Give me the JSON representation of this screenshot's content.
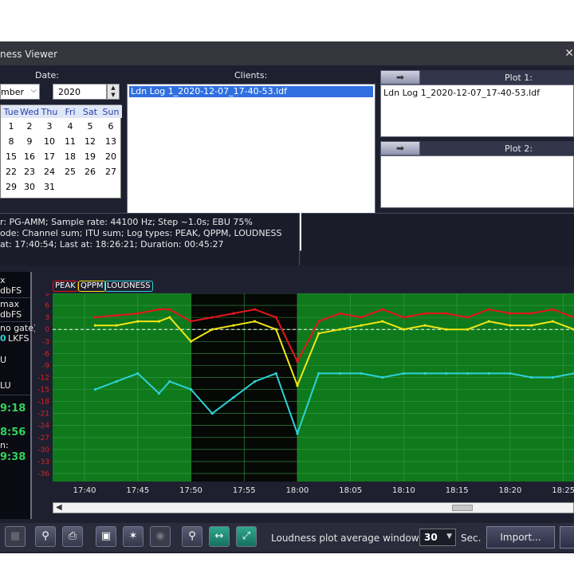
{
  "window": {
    "title": "ness Viewer",
    "close_glyph": "✕"
  },
  "date_pane": {
    "label": "Date:",
    "month_value": "mber",
    "year_value": "2020",
    "calendar": {
      "weekdays": [
        "Tue",
        "Wed",
        "Thu",
        "Fri",
        "Sat",
        "Sun"
      ],
      "weeks": [
        [
          "1",
          "2",
          "3",
          "4",
          "5",
          "6"
        ],
        [
          "8",
          "9",
          "10",
          "11",
          "12",
          "13"
        ],
        [
          "15",
          "16",
          "17",
          "18",
          "19",
          "20"
        ],
        [
          "22",
          "23",
          "24",
          "25",
          "26",
          "27"
        ],
        [
          "29",
          "30",
          "31",
          "",
          "",
          ""
        ]
      ]
    }
  },
  "clients_pane": {
    "label": "Clients:",
    "items": [
      "Ldn Log 1_2020-12-07_17-40-53.ldf"
    ]
  },
  "plot1": {
    "label": "Plot 1:",
    "value": "Ldn Log 1_2020-12-07_17-40-53.ldf"
  },
  "plot2": {
    "label": "Plot 2:",
    "value": ""
  },
  "info": {
    "line1": "r: PG-AMM; Sample rate: 44100 Hz; Step ~1.0s; EBU 75%",
    "line2": "ode: Channel sum; ITU sum;  Log types: PEAK, QPPM, LOUDNESS",
    "line3": "at: 17:40:54; Last at: 18:26:21; Duration: 00:45:27"
  },
  "side_stats": {
    "max_label": "x",
    "max_unit": "dbFS",
    "max2_label": "max",
    "max2_unit": "dbFS",
    "gate_label": "no gate)",
    "lkfs_value": "0",
    "lkfs_unit": "LKFS",
    "lu_label": "U",
    "lu2_label": "LU",
    "time1": "9:18",
    "time2": "8:56",
    "time3_label": "n:",
    "time3": "9:38"
  },
  "legend": [
    "PEAK",
    "QPPM",
    "LOUDNESS"
  ],
  "colors": {
    "peak": "#e8141c",
    "qppm": "#f2e614",
    "loudness": "#2cd2d8",
    "plot_bg": "#0f7a1c",
    "plot_dark": "#050805"
  },
  "chart_data": {
    "type": "line",
    "title": "",
    "xlabel": "",
    "ylabel": "",
    "x_ticks": [
      "17:40",
      "17:45",
      "17:50",
      "17:55",
      "18:00",
      "18:05",
      "18:10",
      "18:15",
      "18:20",
      "18:25"
    ],
    "ylim": [
      -38,
      9
    ],
    "y_ticks": [
      9,
      6,
      3,
      0,
      -3,
      -6,
      -9,
      -12,
      -15,
      -18,
      -21,
      -24,
      -27,
      -30,
      -33,
      -36
    ],
    "reference_line": 0,
    "dark_range": [
      "17:50",
      "18:00"
    ],
    "grid": true,
    "legend_position": "top-left",
    "x": [
      "17:41",
      "17:43",
      "17:45",
      "17:47",
      "17:48",
      "17:50",
      "17:52",
      "17:54",
      "17:56",
      "17:58",
      "18:00",
      "18:02",
      "18:04",
      "18:06",
      "18:08",
      "18:10",
      "18:12",
      "18:14",
      "18:16",
      "18:18",
      "18:20",
      "18:22",
      "18:24",
      "18:26"
    ],
    "series": [
      {
        "name": "PEAK",
        "values": [
          3,
          3.5,
          4,
          5,
          5,
          2,
          3,
          4,
          5,
          3,
          -8,
          2,
          4,
          3,
          5,
          3,
          4,
          4,
          3,
          5,
          4,
          4,
          5,
          3
        ]
      },
      {
        "name": "QPPM",
        "values": [
          1,
          1,
          2,
          2,
          3,
          -3,
          0,
          1,
          2,
          0,
          -14,
          -1,
          0,
          1,
          2,
          0,
          1,
          0,
          0,
          2,
          1,
          1,
          2,
          0
        ]
      },
      {
        "name": "LOUDNESS",
        "values": [
          -15,
          -13,
          -11,
          -16,
          -13,
          -15,
          -21,
          -17,
          -13,
          -11,
          -26,
          -11,
          -11,
          -11,
          -12,
          -11,
          -11,
          -11,
          -11,
          -11,
          -11,
          -12,
          -12,
          -11
        ]
      }
    ]
  },
  "toolbar": {
    "avg_label": "Loudness plot average window size:",
    "avg_value": "30",
    "sec_label": "Sec.",
    "import_label": "Import..."
  }
}
